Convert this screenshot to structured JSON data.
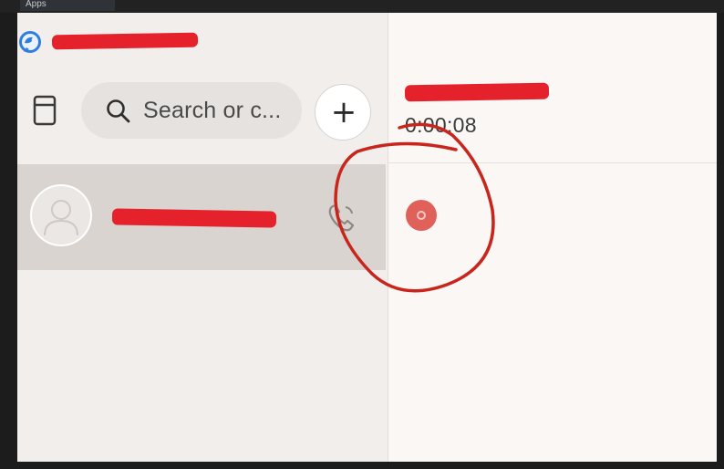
{
  "window": {
    "top_tab_fragment": "Apps"
  },
  "sidebar": {
    "search_placeholder": "Search or c...",
    "add_button_label": "+"
  },
  "call": {
    "timer": "0:00:08"
  },
  "colors": {
    "redaction": "#e5222b",
    "record_indicator": "#e0605a",
    "annotation_circle": "#c8261d"
  }
}
